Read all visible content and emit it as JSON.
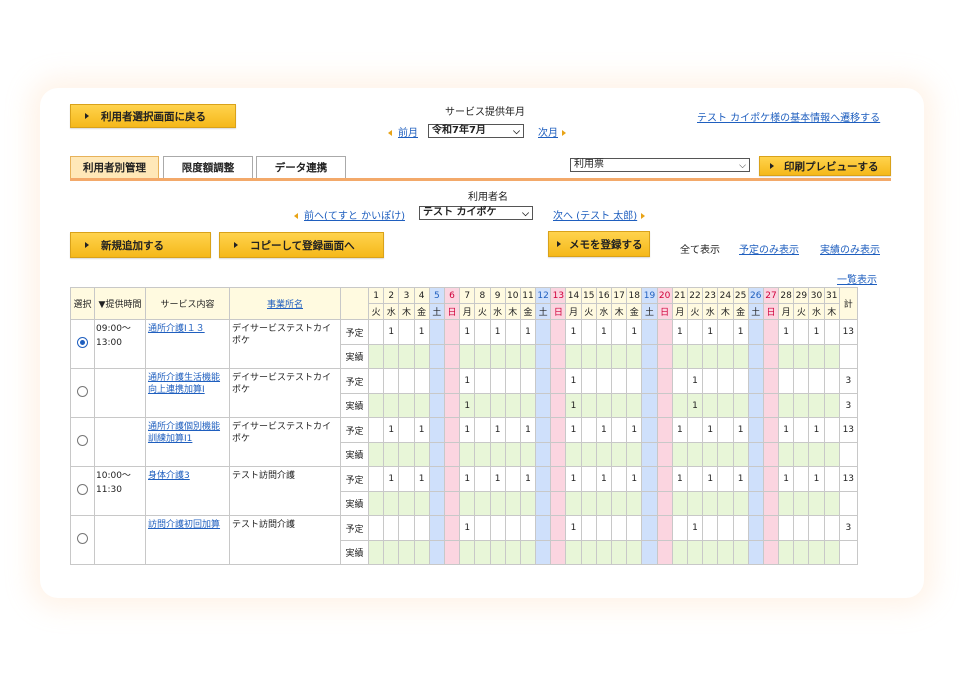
{
  "header": {
    "back_button": "利用者選択画面に戻る",
    "service_month_label": "サービス提供年月",
    "prev_month": "前月",
    "month_value": "令和7年7月",
    "next_month": "次月",
    "basic_info_link": "テスト カイポケ様の基本情報へ遷移する"
  },
  "tabs": [
    "利用者別管理",
    "限度額調整",
    "データ連携"
  ],
  "print": {
    "select_value": "利用票",
    "preview_button": "印刷プレビューする"
  },
  "user": {
    "label": "利用者名",
    "prev": "前へ(てすと かいぽけ)",
    "value": "テスト カイポケ",
    "next": "次へ (テスト 太郎)"
  },
  "actions": {
    "new_add": "新規追加する",
    "copy_register": "コピーして登録画面へ",
    "memo_register": "メモを登録する",
    "show_all": "全て表示",
    "show_plan": "予定のみ表示",
    "show_actual": "実績のみ表示",
    "list_view": "一覧表示"
  },
  "table": {
    "headers": {
      "select": "選択",
      "time": "▼提供時間",
      "service": "サービス内容",
      "office": "事業所名",
      "total": "計"
    },
    "days": [
      "1",
      "2",
      "3",
      "4",
      "5",
      "6",
      "7",
      "8",
      "9",
      "10",
      "11",
      "12",
      "13",
      "14",
      "15",
      "16",
      "17",
      "18",
      "19",
      "20",
      "21",
      "22",
      "23",
      "24",
      "25",
      "26",
      "27",
      "28",
      "29",
      "30",
      "31"
    ],
    "weekdays": [
      "火",
      "水",
      "木",
      "金",
      "土",
      "日",
      "月",
      "火",
      "水",
      "木",
      "金",
      "土",
      "日",
      "月",
      "火",
      "水",
      "木",
      "金",
      "土",
      "日",
      "月",
      "火",
      "水",
      "木",
      "金",
      "土",
      "日",
      "月",
      "火",
      "水",
      "木"
    ],
    "plan_label": "予定",
    "actual_label": "実績",
    "rows": [
      {
        "selected": true,
        "time": "09:00〜 13:00",
        "service": "通所介護Ⅰ１３",
        "office": "デイサービステストカイポケ",
        "plan": [
          "",
          "1",
          "",
          "1",
          "",
          "",
          "1",
          "",
          "1",
          "",
          "1",
          "",
          "",
          "1",
          "",
          "1",
          "",
          "1",
          "",
          "",
          "1",
          "",
          "1",
          "",
          "1",
          "",
          "",
          "1",
          "",
          "1",
          ""
        ],
        "plan_total": "13",
        "actual": [
          "",
          "",
          "",
          "",
          "",
          "",
          "",
          "",
          "",
          "",
          "",
          "",
          "",
          "",
          "",
          "",
          "",
          "",
          "",
          "",
          "",
          "",
          "",
          "",
          "",
          "",
          "",
          "",
          "",
          "",
          ""
        ],
        "actual_total": ""
      },
      {
        "selected": false,
        "time": "",
        "service": "通所介護生活機能向上連携加算Ⅰ",
        "office": "デイサービステストカイポケ",
        "plan": [
          "",
          "",
          "",
          "",
          "",
          "",
          "1",
          "",
          "",
          "",
          "",
          "",
          "",
          "1",
          "",
          "",
          "",
          "",
          "",
          "",
          "",
          "1",
          "",
          "",
          "",
          "",
          "",
          "",
          "",
          "",
          ""
        ],
        "plan_total": "3",
        "actual": [
          "",
          "",
          "",
          "",
          "",
          "",
          "1",
          "",
          "",
          "",
          "",
          "",
          "",
          "1",
          "",
          "",
          "",
          "",
          "",
          "",
          "",
          "1",
          "",
          "",
          "",
          "",
          "",
          "",
          "",
          "",
          ""
        ],
        "actual_total": "3"
      },
      {
        "selected": false,
        "time": "",
        "service": "通所介護個別機能訓練加算Ⅰ1",
        "office": "デイサービステストカイポケ",
        "plan": [
          "",
          "1",
          "",
          "1",
          "",
          "",
          "1",
          "",
          "1",
          "",
          "1",
          "",
          "",
          "1",
          "",
          "1",
          "",
          "1",
          "",
          "",
          "1",
          "",
          "1",
          "",
          "1",
          "",
          "",
          "1",
          "",
          "1",
          ""
        ],
        "plan_total": "13",
        "actual": [
          "",
          "",
          "",
          "",
          "",
          "",
          "",
          "",
          "",
          "",
          "",
          "",
          "",
          "",
          "",
          "",
          "",
          "",
          "",
          "",
          "",
          "",
          "",
          "",
          "",
          "",
          "",
          "",
          "",
          "",
          ""
        ],
        "actual_total": ""
      },
      {
        "selected": false,
        "time": "10:00〜 11:30",
        "service": "身体介護3",
        "office": "テスト訪問介護",
        "plan": [
          "",
          "1",
          "",
          "1",
          "",
          "",
          "1",
          "",
          "1",
          "",
          "1",
          "",
          "",
          "1",
          "",
          "1",
          "",
          "1",
          "",
          "",
          "1",
          "",
          "1",
          "",
          "1",
          "",
          "",
          "1",
          "",
          "1",
          ""
        ],
        "plan_total": "13",
        "actual": [
          "",
          "",
          "",
          "",
          "",
          "",
          "",
          "",
          "",
          "",
          "",
          "",
          "",
          "",
          "",
          "",
          "",
          "",
          "",
          "",
          "",
          "",
          "",
          "",
          "",
          "",
          "",
          "",
          "",
          "",
          ""
        ],
        "actual_total": ""
      },
      {
        "selected": false,
        "time": "",
        "service": "訪問介護初回加算",
        "office": "テスト訪問介護",
        "plan": [
          "",
          "",
          "",
          "",
          "",
          "",
          "1",
          "",
          "",
          "",
          "",
          "",
          "",
          "1",
          "",
          "",
          "",
          "",
          "",
          "",
          "",
          "1",
          "",
          "",
          "",
          "",
          "",
          "",
          "",
          "",
          ""
        ],
        "plan_total": "3",
        "actual": [
          "",
          "",
          "",
          "",
          "",
          "",
          "",
          "",
          "",
          "",
          "",
          "",
          "",
          "",
          "",
          "",
          "",
          "",
          "",
          "",
          "",
          "",
          "",
          "",
          "",
          "",
          "",
          "",
          "",
          "",
          ""
        ],
        "actual_total": ""
      }
    ]
  },
  "colors": {
    "accent": "#f5b81a",
    "link": "#1f5fbf",
    "saturday": "#cfe0fb",
    "sunday": "#fbd5e0",
    "actual_row": "#e8f6d8",
    "tab_active": "#ffe8b8"
  }
}
